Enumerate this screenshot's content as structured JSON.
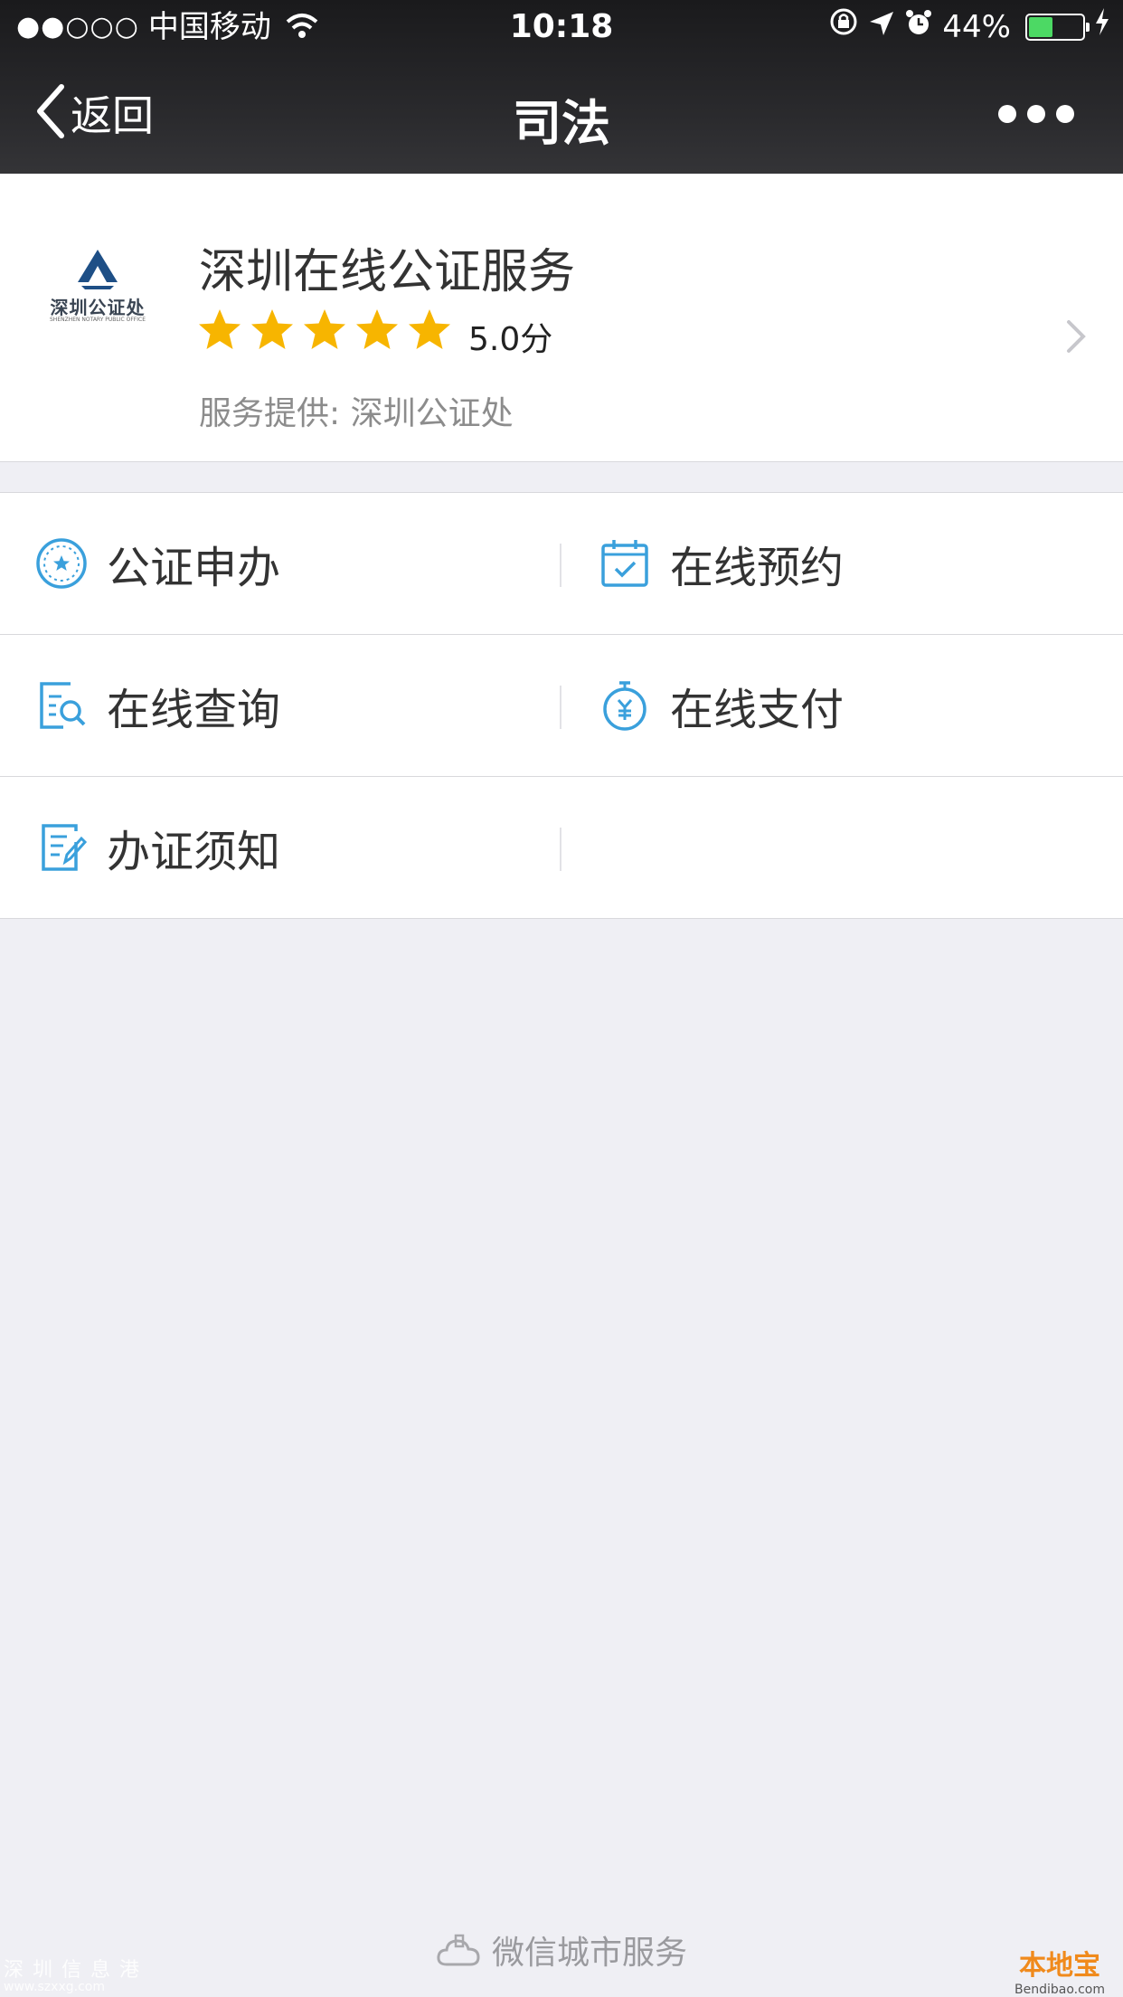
{
  "status_bar": {
    "signal_dots": "●●○○○",
    "carrier": "中国移动",
    "time": "10:18",
    "battery_percent": "44%",
    "battery_level": 0.44,
    "icons": [
      "wifi-icon",
      "orientation-lock-icon",
      "location-icon",
      "alarm-icon",
      "battery-icon",
      "charging-icon"
    ]
  },
  "nav": {
    "back_label": "返回",
    "title": "司法",
    "more_icon": "more-dots-icon"
  },
  "service": {
    "logo_text": "深圳公证处",
    "logo_subtext": "SHENZHEN NOTARY PUBLIC OFFICE",
    "title": "深圳在线公证服务",
    "star_count": 5,
    "rating": "5.0分",
    "provider_label": "服务提供:",
    "provider_name": "深圳公证处"
  },
  "menu": {
    "items": [
      {
        "label": "公证申办",
        "icon": "notary-apply-icon"
      },
      {
        "label": "在线预约",
        "icon": "calendar-check-icon"
      },
      {
        "label": "在线查询",
        "icon": "document-search-icon"
      },
      {
        "label": "在线支付",
        "icon": "yuan-timer-icon"
      },
      {
        "label": "办证须知",
        "icon": "document-edit-icon"
      }
    ]
  },
  "footer": {
    "label": "微信城市服务",
    "icon": "city-cloud-icon"
  },
  "watermarks": {
    "left": "深圳信息港",
    "left_url": "www.szxxg.com",
    "right": "本地宝",
    "right_url": "Bendibao.com"
  },
  "colors": {
    "accent_blue": "#3aa0dc",
    "star": "#f7b500",
    "background": "#efeff4",
    "battery_green": "#4cd964"
  }
}
